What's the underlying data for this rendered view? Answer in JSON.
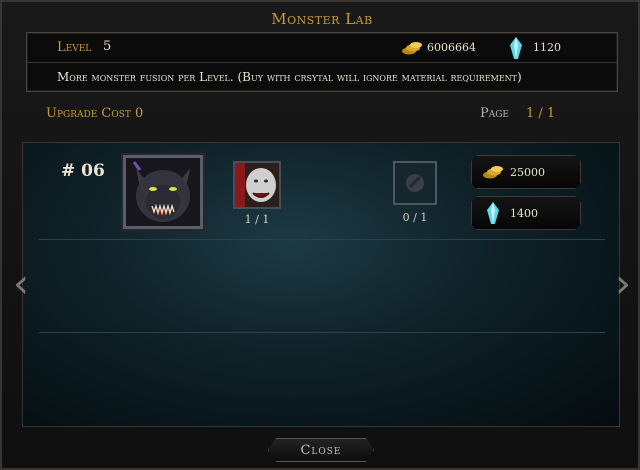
{
  "title": "Monster Lab",
  "info": {
    "level_label": "Level",
    "level_value": "5",
    "gold": "6006664",
    "crystal": "1120",
    "description": "More monster fusion per Level. (Buy with crsytal will ignore material requirement)"
  },
  "upgrade_cost": "Upgrade Cost 0",
  "page": {
    "label": "Page",
    "value": "1 / 1"
  },
  "entry": {
    "number": "# 06",
    "material_count": "1 / 1",
    "slot_count": "0 / 1",
    "gold_cost": "25000",
    "crystal_cost": "1400"
  },
  "close_label": "Close",
  "colors": {
    "gold_text": "#c79a3a",
    "crystal": "#5fd6e6",
    "gold_coin": "#e8b93a"
  },
  "icons": [
    "gold-icon",
    "crystal-icon",
    "werewolf-portrait",
    "white-beast-portrait",
    "empty-material-slot-icon",
    "arrow-left-icon",
    "arrow-right-icon"
  ]
}
